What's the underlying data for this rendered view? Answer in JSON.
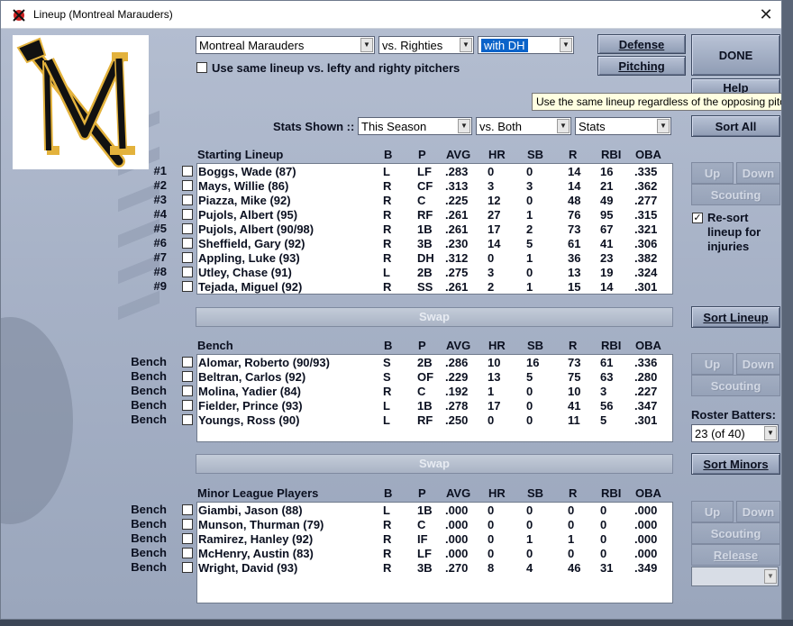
{
  "window": {
    "title": "Lineup (Montreal Marauders)"
  },
  "controls": {
    "team_select": "Montreal Marauders",
    "vs_select": "vs. Righties",
    "dh_select": "with DH",
    "same_lineup_label": "Use same lineup vs. lefty and righty pitchers",
    "tooltip": "Use the same lineup regardless of the opposing pitcher",
    "stats_shown_label": "Stats Shown ::",
    "season_select": "This Season",
    "vs_both_select": "vs. Both",
    "stats_select": "Stats"
  },
  "buttons": {
    "defense": "Defense",
    "pitching": "Pitching",
    "done": "DONE",
    "help": "Help",
    "sort_all": "Sort All",
    "up": "Up",
    "down": "Down",
    "scouting": "Scouting",
    "sort_lineup": "Sort Lineup",
    "sort_minors": "Sort Minors",
    "release": "Release",
    "swap": "Swap"
  },
  "resort": {
    "label_1": "Re-sort",
    "label_2": "lineup for",
    "label_3": "injuries",
    "checked": true
  },
  "roster": {
    "label": "Roster Batters:",
    "value": "23 (of 40)"
  },
  "columns": [
    "B",
    "P",
    "AVG",
    "HR",
    "SB",
    "R",
    "RBI",
    "OBA"
  ],
  "starting": {
    "header": "Starting Lineup",
    "rows": [
      {
        "slot": "#1",
        "name": "Boggs, Wade (87)",
        "b": "L",
        "p": "LF",
        "avg": ".283",
        "hr": "0",
        "sb": "0",
        "r": "14",
        "rbi": "16",
        "oba": ".335"
      },
      {
        "slot": "#2",
        "name": "Mays, Willie (86)",
        "b": "R",
        "p": "CF",
        "avg": ".313",
        "hr": "3",
        "sb": "3",
        "r": "14",
        "rbi": "21",
        "oba": ".362"
      },
      {
        "slot": "#3",
        "name": "Piazza, Mike (92)",
        "b": "R",
        "p": "C",
        "avg": ".225",
        "hr": "12",
        "sb": "0",
        "r": "48",
        "rbi": "49",
        "oba": ".277"
      },
      {
        "slot": "#4",
        "name": "Pujols, Albert (95)",
        "b": "R",
        "p": "RF",
        "avg": ".261",
        "hr": "27",
        "sb": "1",
        "r": "76",
        "rbi": "95",
        "oba": ".315"
      },
      {
        "slot": "#5",
        "name": "Pujols, Albert (90/98)",
        "b": "R",
        "p": "1B",
        "avg": ".261",
        "hr": "17",
        "sb": "2",
        "r": "73",
        "rbi": "67",
        "oba": ".321"
      },
      {
        "slot": "#6",
        "name": "Sheffield, Gary (92)",
        "b": "R",
        "p": "3B",
        "avg": ".230",
        "hr": "14",
        "sb": "5",
        "r": "61",
        "rbi": "41",
        "oba": ".306"
      },
      {
        "slot": "#7",
        "name": "Appling, Luke (93)",
        "b": "R",
        "p": "DH",
        "avg": ".312",
        "hr": "0",
        "sb": "1",
        "r": "36",
        "rbi": "23",
        "oba": ".382"
      },
      {
        "slot": "#8",
        "name": "Utley, Chase (91)",
        "b": "L",
        "p": "2B",
        "avg": ".275",
        "hr": "3",
        "sb": "0",
        "r": "13",
        "rbi": "19",
        "oba": ".324"
      },
      {
        "slot": "#9",
        "name": "Tejada, Miguel (92)",
        "b": "R",
        "p": "SS",
        "avg": ".261",
        "hr": "2",
        "sb": "1",
        "r": "15",
        "rbi": "14",
        "oba": ".301"
      }
    ]
  },
  "bench": {
    "header": "Bench",
    "rows": [
      {
        "slot": "Bench",
        "name": "Alomar, Roberto (90/93)",
        "b": "S",
        "p": "2B",
        "avg": ".286",
        "hr": "10",
        "sb": "16",
        "r": "73",
        "rbi": "61",
        "oba": ".336"
      },
      {
        "slot": "Bench",
        "name": "Beltran, Carlos (92)",
        "b": "S",
        "p": "OF",
        "avg": ".229",
        "hr": "13",
        "sb": "5",
        "r": "75",
        "rbi": "63",
        "oba": ".280"
      },
      {
        "slot": "Bench",
        "name": "Molina, Yadier (84)",
        "b": "R",
        "p": "C",
        "avg": ".192",
        "hr": "1",
        "sb": "0",
        "r": "10",
        "rbi": "3",
        "oba": ".227"
      },
      {
        "slot": "Bench",
        "name": "Fielder, Prince (93)",
        "b": "L",
        "p": "1B",
        "avg": ".278",
        "hr": "17",
        "sb": "0",
        "r": "41",
        "rbi": "56",
        "oba": ".347"
      },
      {
        "slot": "Bench",
        "name": "Youngs, Ross (90)",
        "b": "L",
        "p": "RF",
        "avg": ".250",
        "hr": "0",
        "sb": "0",
        "r": "11",
        "rbi": "5",
        "oba": ".301"
      }
    ]
  },
  "minors": {
    "header": "Minor League Players",
    "rows": [
      {
        "slot": "Bench",
        "name": "Giambi, Jason (88)",
        "b": "L",
        "p": "1B",
        "avg": ".000",
        "hr": "0",
        "sb": "0",
        "r": "0",
        "rbi": "0",
        "oba": ".000"
      },
      {
        "slot": "Bench",
        "name": "Munson, Thurman (79)",
        "b": "R",
        "p": "C",
        "avg": ".000",
        "hr": "0",
        "sb": "0",
        "r": "0",
        "rbi": "0",
        "oba": ".000"
      },
      {
        "slot": "Bench",
        "name": "Ramirez, Hanley (92)",
        "b": "R",
        "p": "IF",
        "avg": ".000",
        "hr": "0",
        "sb": "1",
        "r": "1",
        "rbi": "0",
        "oba": ".000"
      },
      {
        "slot": "Bench",
        "name": "McHenry, Austin (83)",
        "b": "R",
        "p": "LF",
        "avg": ".000",
        "hr": "0",
        "sb": "0",
        "r": "0",
        "rbi": "0",
        "oba": ".000"
      },
      {
        "slot": "Bench",
        "name": "Wright, David (93)",
        "b": "R",
        "p": "3B",
        "avg": ".270",
        "hr": "8",
        "sb": "4",
        "r": "46",
        "rbi": "31",
        "oba": ".349"
      }
    ]
  },
  "colors": {
    "panel": "#a9b4c8",
    "selection": "#0a63c9",
    "logo_gold": "#e3b23c"
  }
}
